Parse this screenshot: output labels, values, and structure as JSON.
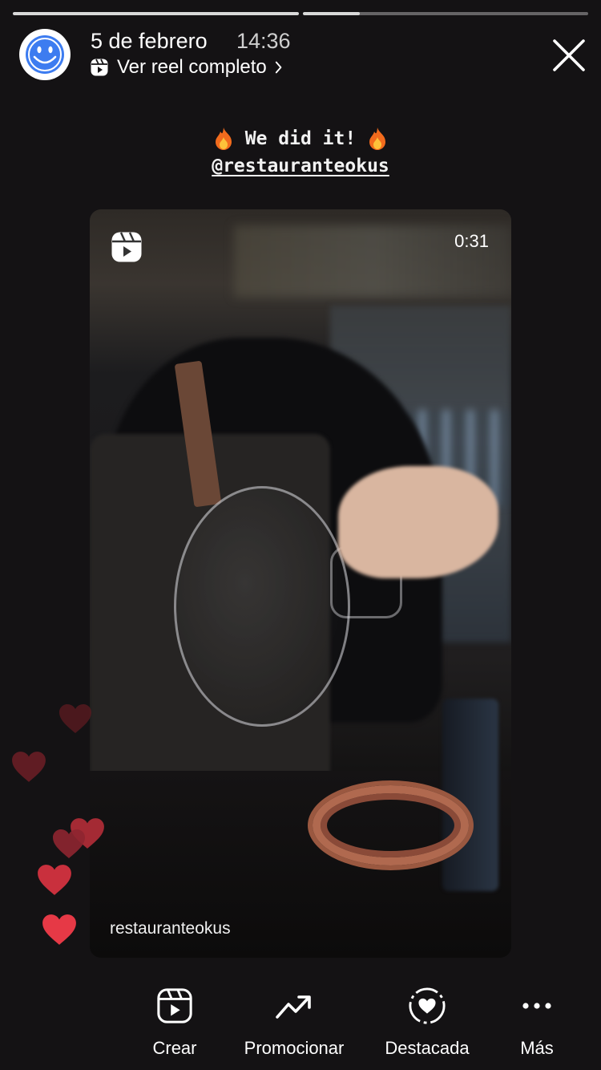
{
  "header": {
    "date": "5 de febrero",
    "time": "14:36",
    "reel_link": "Ver reel completo",
    "progress": [
      1.0,
      0.2
    ]
  },
  "caption": {
    "line1": "We did it!",
    "line2": "@restauranteokus"
  },
  "reel": {
    "duration": "0:31",
    "handle": "restauranteokus"
  },
  "actions": [
    {
      "label": "Crear",
      "icon": "reels-create-icon"
    },
    {
      "label": "Promocionar",
      "icon": "trending-up-icon"
    },
    {
      "label": "Destacada",
      "icon": "highlight-heart-icon"
    },
    {
      "label": "Más",
      "icon": "more-dots-icon"
    }
  ],
  "colors": {
    "background": "#141214",
    "heart_bright": "#e63946",
    "heart_dim": "#7a1f27"
  }
}
